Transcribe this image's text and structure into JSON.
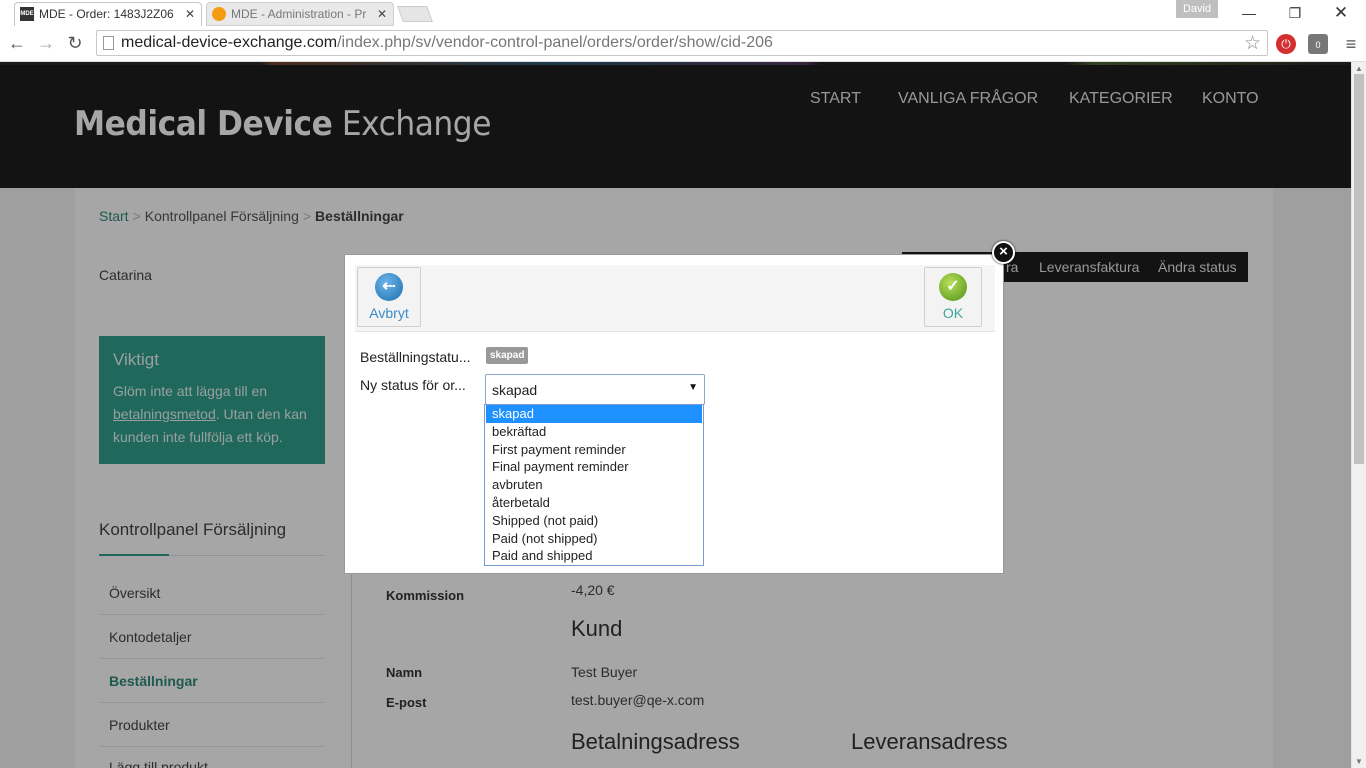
{
  "browser": {
    "tabs": [
      {
        "title": "MDE - Order: 1483J2Z06",
        "favicon": "MDE",
        "close": "✕",
        "active": true
      },
      {
        "title": "MDE - Administration - Pr",
        "favicon": "joomla-icon",
        "close": "✕",
        "active": false
      }
    ],
    "user": "David",
    "url_domain": "medical-device-exchange.com",
    "url_path": "/index.php/sv/vendor-control-panel/orders/order/show/cid-206",
    "ext_badge": "0"
  },
  "site": {
    "logo_bold": "Medical Device",
    "logo_light": "Exchange",
    "nav": [
      "START",
      "VANLIGA FRÅGOR",
      "KATEGORIER",
      "KONTO"
    ],
    "breadcrumb": {
      "start": "Start",
      "panel": "Kontrollpanel Försäljning",
      "current": "Beställningar"
    },
    "username": "Catarina",
    "notice": {
      "title": "Viktigt",
      "text_before": "Glöm inte att lägga till en ",
      "link": "betalningsmetod",
      "text_after": ". Utan den kan kunden inte fullfölja ett köp."
    },
    "sidebar": {
      "title": "Kontrollpanel Försäljning",
      "items": [
        "Översikt",
        "Kontodetaljer",
        "Beställningar",
        "Produkter",
        "Lägg till produkt"
      ]
    },
    "toolbar": {
      "partial": "ra",
      "delivery_invoice": "Leveransfaktura",
      "change_status": "Ändra status"
    },
    "fields": {
      "commission_label": "Kommission",
      "commission_value": "-4,20 €",
      "customer_title": "Kund",
      "name_label": "Namn",
      "name_value": "Test Buyer",
      "email_label": "E-post",
      "email_value": "test.buyer@qe-x.com",
      "billing_title": "Betalningsadress",
      "shipping_title": "Leveransadress"
    }
  },
  "modal": {
    "cancel_label": "Avbryt",
    "ok_label": "OK",
    "order_status_label": "Beställningstatu...",
    "order_status_badge": "skapad",
    "new_status_label": "Ny status för or...",
    "select_value": "skapad",
    "options": [
      "skapad",
      "bekräftad",
      "First payment reminder",
      "Final payment reminder",
      "avbruten",
      "återbetald",
      "Shipped (not paid)",
      "Paid (not shipped)",
      "Paid and shipped"
    ],
    "selected_index": 0
  },
  "colors": {
    "accent": "#32a08c",
    "header_bg": "#1e1e1e",
    "select_highlight": "#1e90ff"
  }
}
